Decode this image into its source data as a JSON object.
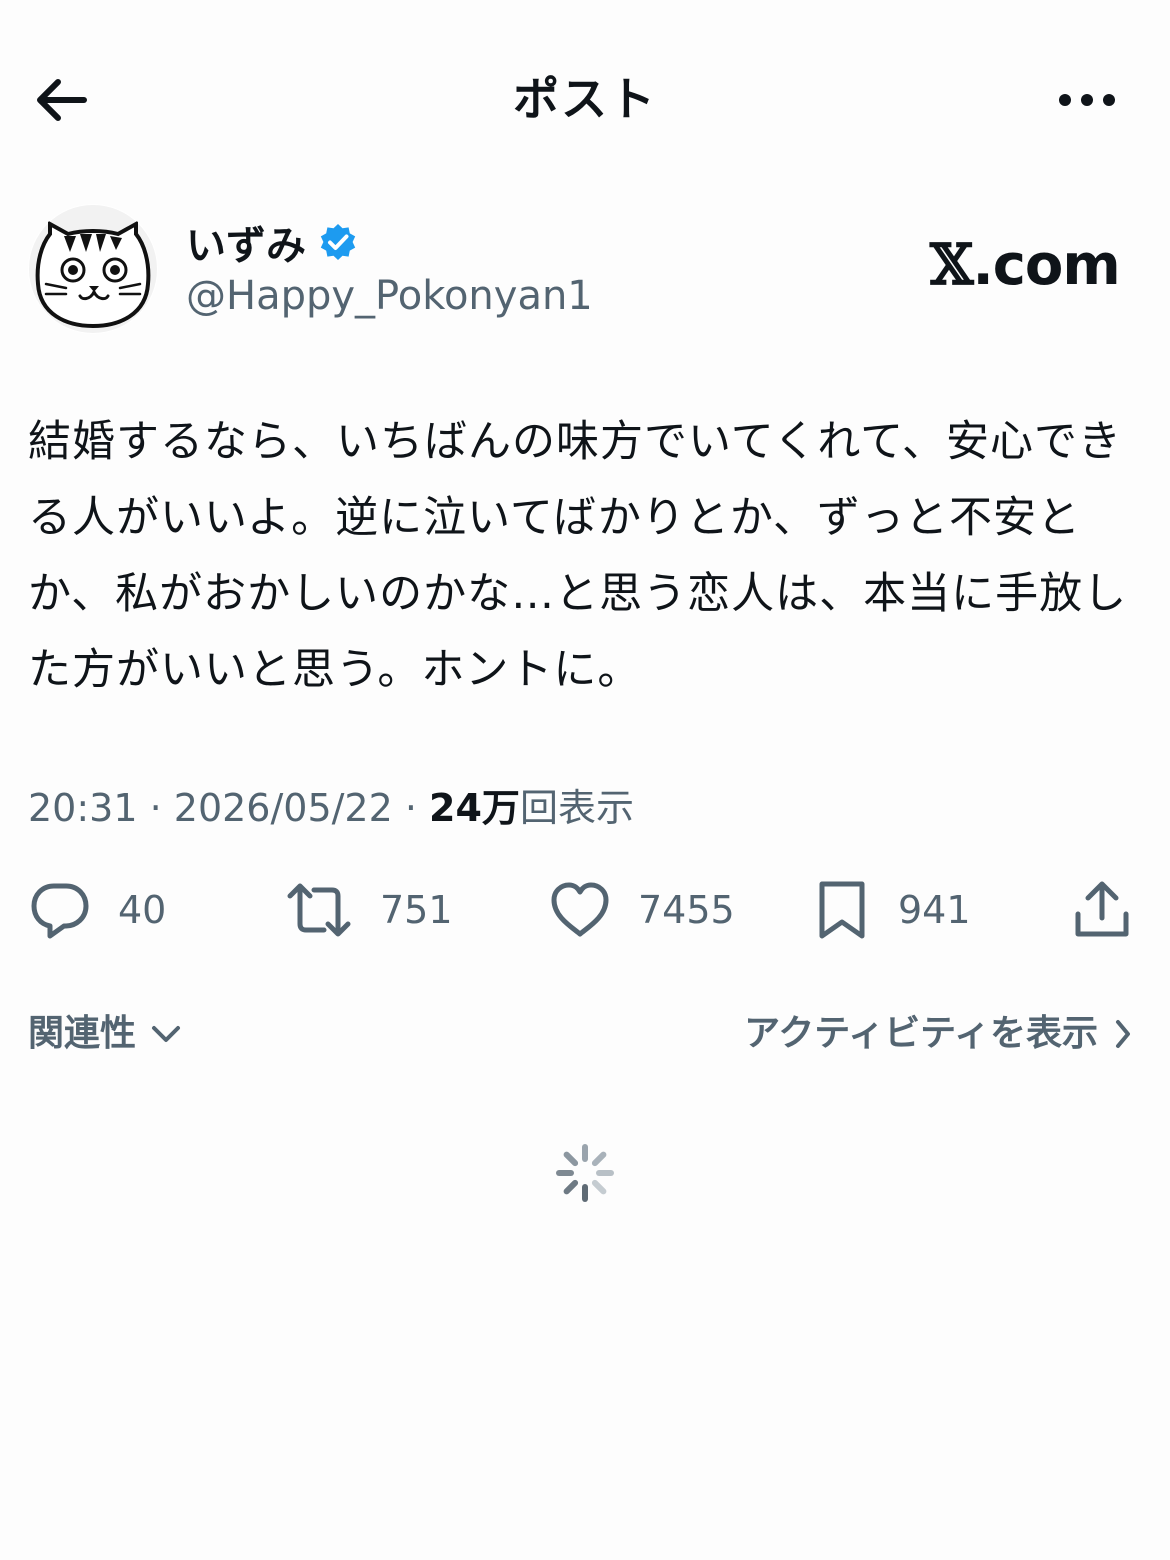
{
  "header": {
    "title": "ポスト",
    "back_icon": "arrow-left-icon",
    "more_icon": "more-horizontal-icon"
  },
  "author": {
    "name": "いずみ",
    "handle": "@Happy_Pokonyan1",
    "verified": true,
    "avatar_icon": "cat-avatar-icon"
  },
  "brand": {
    "x": "𝕏",
    "domain": ".com"
  },
  "post": {
    "text": "結婚するなら、いちばんの味方でいてくれて、安心できる人がいいよ。逆に泣いてばかりとか、ずっと不安とか、私がおかしいのかな…と思う恋人は、本当に手放した方がいいと思う。ホントに。"
  },
  "meta": {
    "time": "20:31",
    "date": "2026/05/22",
    "separator": " · ",
    "views_count": "24万",
    "views_label": "回表示"
  },
  "actions": {
    "reply_count": "40",
    "repost_count": "751",
    "like_count": "7455",
    "bookmark_count": "941"
  },
  "replies_bar": {
    "sort_label": "関連性",
    "activity_label": "アクティビティを表示"
  },
  "colors": {
    "text": "#0f1419",
    "secondary": "#536471",
    "verified_blue": "#1d9bf0",
    "background": "#fdfdfd"
  }
}
